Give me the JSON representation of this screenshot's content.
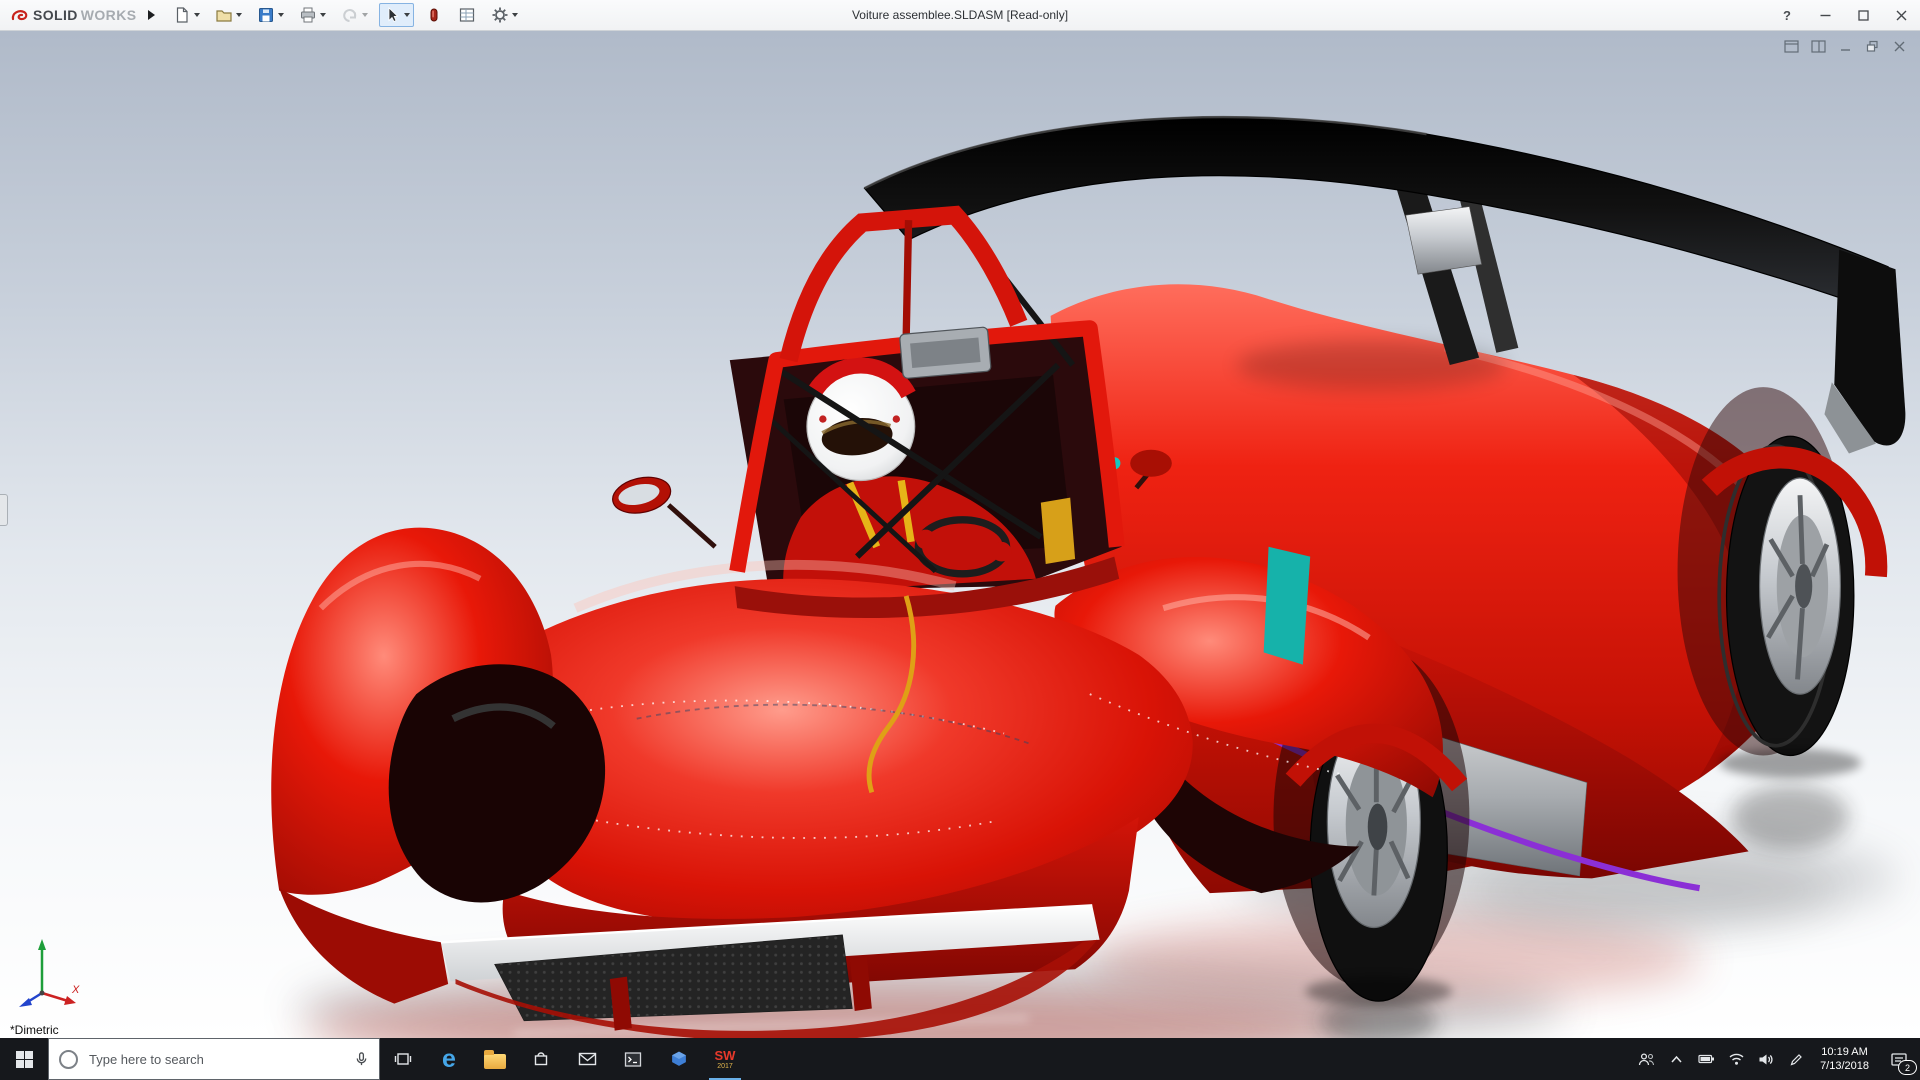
{
  "titlebar": {
    "brand_solid": "SOLID",
    "brand_works": "WORKS",
    "title": "Voiture assemblee.SLDASM [Read-only]",
    "help_glyph": "?"
  },
  "toolbar": {
    "buttons": [
      "new-document",
      "open",
      "save",
      "print",
      "undo",
      "select",
      "appearance",
      "design-table",
      "options"
    ]
  },
  "viewport": {
    "view_label": "*Dimetric",
    "triad_x_label": "X",
    "scene_colors": {
      "car_red": "#e31408",
      "wing_black": "#101010",
      "rim_silver": "#c9ccd0",
      "trim_purple": "#8b2fd6",
      "accent_teal": "#16b2aa",
      "helmet_white": "#f4f4f4"
    }
  },
  "taskbar": {
    "search_placeholder": "Type here to search",
    "edge_glyph": "e",
    "solidworks_label": "SW",
    "solidworks_year": "2017",
    "time": "10:19 AM",
    "date": "7/13/2018",
    "notification_count": "2"
  }
}
